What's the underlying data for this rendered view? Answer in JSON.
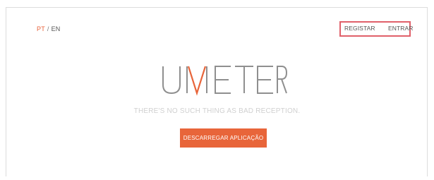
{
  "header": {
    "lang_active": "PT",
    "lang_separator": "/",
    "lang_other": "EN",
    "register_label": "REGISTAR",
    "login_label": "ENTRAR"
  },
  "hero": {
    "logo_text": "UMETER",
    "tagline": "THERE'S NO SUCH THING AS BAD RECEPTION.",
    "cta_label": "DESCARREGAR APLICAÇÃO"
  },
  "colors": {
    "accent": "#e8653a",
    "highlight_border": "#e0606a",
    "logo_gray": "#909090"
  }
}
